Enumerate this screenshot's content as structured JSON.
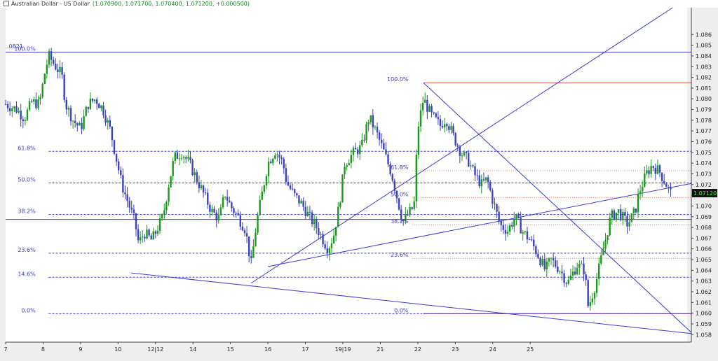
{
  "window": {
    "title": "Australian Dollar - US Dollar",
    "ohlc_summary": "(1.070900, 1.071700, 1.070400, 1.071200, +0.000500)"
  },
  "chart_data": {
    "type": "candlestick",
    "instrument": "Australian Dollar - US Dollar",
    "open": 1.0709,
    "high": 1.0717,
    "low": 1.0704,
    "close": 1.0712,
    "change": 0.0005,
    "last_price_label": "1.07120",
    "ylim": [
      1.0573,
      1.0885
    ],
    "xlim": [
      7.0,
      25.3
    ],
    "y_ticks": [
      1.058,
      1.059,
      1.06,
      1.061,
      1.062,
      1.063,
      1.064,
      1.065,
      1.066,
      1.067,
      1.068,
      1.069,
      1.07,
      1.071,
      1.072,
      1.073,
      1.074,
      1.075,
      1.076,
      1.077,
      1.078,
      1.079,
      1.08,
      1.081,
      1.082,
      1.083,
      1.084,
      1.085,
      1.086
    ],
    "x_ticks": [
      {
        "x": 7,
        "label": "7"
      },
      {
        "x": 8,
        "label": "8"
      },
      {
        "x": 9,
        "label": "9"
      },
      {
        "x": 10,
        "label": "10"
      },
      {
        "x": 11,
        "label": "12|12"
      },
      {
        "x": 12,
        "label": "14"
      },
      {
        "x": 13,
        "label": "15"
      },
      {
        "x": 14,
        "label": "16"
      },
      {
        "x": 15,
        "label": "17"
      },
      {
        "x": 16,
        "label": "19|19"
      },
      {
        "x": 17,
        "label": "21"
      },
      {
        "x": 18,
        "label": "22"
      },
      {
        "x": 19,
        "label": "23"
      },
      {
        "x": 20,
        "label": "24"
      },
      {
        "x": 21,
        "label": "25"
      }
    ],
    "left_edge_price_label": ".0821",
    "candle_anchors": [
      [
        7.0,
        1.0795
      ],
      [
        7.3,
        1.079
      ],
      [
        7.5,
        1.0782
      ],
      [
        7.7,
        1.0797
      ],
      [
        7.9,
        1.0795
      ],
      [
        8.05,
        1.0825
      ],
      [
        8.15,
        1.084
      ],
      [
        8.3,
        1.0832
      ],
      [
        8.5,
        1.0822
      ],
      [
        8.6,
        1.0795
      ],
      [
        8.8,
        1.078
      ],
      [
        9.0,
        1.0772
      ],
      [
        9.2,
        1.0795
      ],
      [
        9.4,
        1.08
      ],
      [
        9.6,
        1.079
      ],
      [
        9.8,
        1.077
      ],
      [
        9.95,
        1.0745
      ],
      [
        10.1,
        1.072
      ],
      [
        10.3,
        1.07
      ],
      [
        10.45,
        1.0685
      ],
      [
        10.55,
        1.0665
      ],
      [
        10.7,
        1.0675
      ],
      [
        10.9,
        1.0668
      ],
      [
        11.2,
        1.069
      ],
      [
        11.35,
        1.072
      ],
      [
        11.5,
        1.0745
      ],
      [
        11.7,
        1.075
      ],
      [
        11.9,
        1.074
      ],
      [
        12.1,
        1.0725
      ],
      [
        12.3,
        1.071
      ],
      [
        12.5,
        1.0695
      ],
      [
        12.7,
        1.0688
      ],
      [
        12.85,
        1.0712
      ],
      [
        13.0,
        1.07
      ],
      [
        13.2,
        1.069
      ],
      [
        13.4,
        1.0678
      ],
      [
        13.55,
        1.0645
      ],
      [
        13.7,
        1.0685
      ],
      [
        14.0,
        1.074
      ],
      [
        14.2,
        1.0752
      ],
      [
        14.4,
        1.074
      ],
      [
        14.5,
        1.0722
      ],
      [
        14.7,
        1.071
      ],
      [
        14.9,
        1.0702
      ],
      [
        15.1,
        1.069
      ],
      [
        15.3,
        1.068
      ],
      [
        15.45,
        1.067
      ],
      [
        15.6,
        1.066
      ],
      [
        15.75,
        1.0672
      ],
      [
        15.9,
        1.07
      ],
      [
        16.05,
        1.074
      ],
      [
        16.3,
        1.075
      ],
      [
        16.5,
        1.0755
      ],
      [
        16.7,
        1.0783
      ],
      [
        16.9,
        1.0768
      ],
      [
        17.1,
        1.075
      ],
      [
        17.3,
        1.073
      ],
      [
        17.5,
        1.07
      ],
      [
        17.6,
        1.0685
      ],
      [
        17.9,
        1.07
      ],
      [
        18.0,
        1.0772
      ],
      [
        18.15,
        1.08
      ],
      [
        18.35,
        1.0785
      ],
      [
        18.6,
        1.0775
      ],
      [
        18.75,
        1.0782
      ],
      [
        18.95,
        1.0765
      ],
      [
        19.15,
        1.075
      ],
      [
        19.35,
        1.0742
      ],
      [
        19.5,
        1.073
      ],
      [
        19.7,
        1.072
      ],
      [
        19.85,
        1.0725
      ],
      [
        20.0,
        1.0705
      ],
      [
        20.2,
        1.0682
      ],
      [
        20.4,
        1.0677
      ],
      [
        20.6,
        1.069
      ],
      [
        20.8,
        1.0676
      ],
      [
        21.0,
        1.0668
      ],
      [
        21.2,
        1.0655
      ],
      [
        21.4,
        1.064
      ],
      [
        21.55,
        1.065
      ],
      [
        21.8,
        1.064
      ],
      [
        22.0,
        1.0628
      ],
      [
        22.25,
        1.0645
      ],
      [
        22.45,
        1.064
      ],
      [
        22.55,
        1.0605
      ],
      [
        22.75,
        1.0628
      ],
      [
        22.95,
        1.066
      ],
      [
        23.15,
        1.069
      ],
      [
        23.35,
        1.0695
      ],
      [
        23.6,
        1.0683
      ],
      [
        23.8,
        1.0695
      ],
      [
        23.9,
        1.0712
      ],
      [
        24.1,
        1.073
      ],
      [
        24.25,
        1.0738
      ],
      [
        24.45,
        1.0732
      ],
      [
        24.6,
        1.0722
      ],
      [
        24.75,
        1.0712
      ]
    ],
    "horizontal_lines": [
      {
        "price": 1.08435,
        "color": "#3a3ad6",
        "style": "solid",
        "from": 7.0,
        "to": 25.3
      },
      {
        "price": 1.06875,
        "color": "#3a3ad6",
        "style": "solid",
        "from": 7.0,
        "to": 25.3
      },
      {
        "price": 1.0815,
        "color": "#e0553a",
        "style": "solid",
        "from": 18.15,
        "to": 25.3
      },
      {
        "price": 1.05995,
        "color": "#8a1a6a",
        "style": "solid",
        "from": 18.15,
        "to": 25.3
      }
    ],
    "fibonacci_sets": [
      {
        "name": "fib-left",
        "color": "#3a3ad6",
        "label_color": "#3a3ad6",
        "label_x": 7.8,
        "from": 8.15,
        "to": 25.3,
        "style": "dashed",
        "levels": [
          {
            "label": "100.0%",
            "price": 1.08435,
            "line": false
          },
          {
            "label": "61.8%",
            "price": 1.0751
          },
          {
            "label": "50.0%",
            "price": 1.07215
          },
          {
            "label": "38.2%",
            "price": 1.0692
          },
          {
            "label": "23.6%",
            "price": 1.0656
          },
          {
            "label": "14.6%",
            "price": 1.06335
          },
          {
            "label": "0.0%",
            "price": 1.05995
          }
        ]
      },
      {
        "name": "fib-right",
        "color": "#e8734a",
        "label_color": "#3a3ad6",
        "label_x": 17.75,
        "from": 17.85,
        "to": 25.3,
        "style": "dotted",
        "levels": [
          {
            "label": "100.0%",
            "price": 1.0815,
            "line": false
          },
          {
            "label": "61.8%",
            "price": 1.0733
          },
          {
            "label": "50.0%",
            "price": 1.07077
          },
          {
            "label": "38.2%",
            "price": 1.06825
          },
          {
            "label": "23.6%",
            "price": 1.06512
          },
          {
            "label": "0.0%",
            "price": 1.05995,
            "line": false
          }
        ]
      }
    ],
    "trend_lines": [
      {
        "x1": 10.35,
        "y1": 1.06375,
        "x2": 25.3,
        "y2": 1.0581
      },
      {
        "x1": 13.55,
        "y1": 1.0628,
        "x2": 24.8,
        "y2": 1.0885
      },
      {
        "x1": 14.0,
        "y1": 1.06435,
        "x2": 25.3,
        "y2": 1.0721
      },
      {
        "x1": 18.15,
        "y1": 1.0815,
        "x2": 25.3,
        "y2": 1.0582
      }
    ],
    "colors": {
      "bull": "#1a9a1a",
      "bear": "#3d42c0",
      "axis": "#444444",
      "labels": "#3a3ad6",
      "last_price_bg": "#111111",
      "last_price_fg": "#33ff33"
    }
  }
}
